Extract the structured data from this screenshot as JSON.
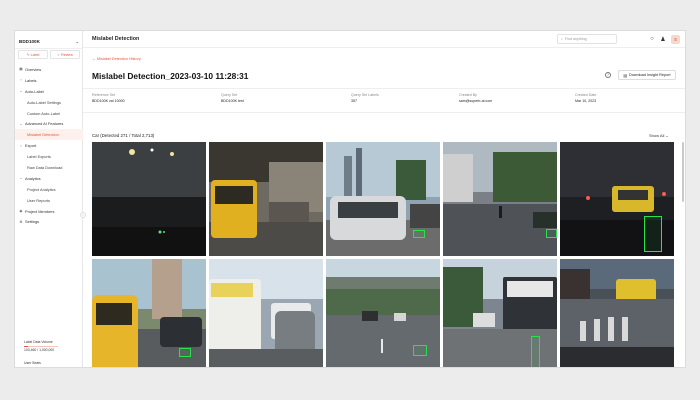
{
  "sidebar": {
    "workspace": "BDD100K",
    "label_button": "Label",
    "review_button": "Review",
    "items": [
      {
        "label": "Overview",
        "icon": "grid-icon"
      },
      {
        "label": "Labels",
        "icon": "chevron-right-icon"
      },
      {
        "label": "Auto-Label",
        "icon": "chevron-down-icon"
      },
      {
        "label": "Auto-Label Settings"
      },
      {
        "label": "Custom Auto-Label"
      },
      {
        "label": "Advanced AI Features",
        "icon": "chevron-down-icon"
      },
      {
        "label": "Mislabel Detection"
      },
      {
        "label": "Export",
        "icon": "chevron-right-icon"
      },
      {
        "label": "Label Exports"
      },
      {
        "label": "Raw Data Download"
      },
      {
        "label": "Analytics",
        "icon": "chevron-down-icon"
      },
      {
        "label": "Project Analytics"
      },
      {
        "label": "User Reports"
      },
      {
        "label": "Project Members",
        "icon": "people-icon"
      },
      {
        "label": "Settings",
        "icon": "gear-icon"
      }
    ],
    "usage_title": "Label Data Volume",
    "usage_value": "103,460 / 1,000,000",
    "usage_fraction": 0.103,
    "user_seats": "User Seats"
  },
  "topbar": {
    "title": "Mislabel Detection",
    "search_placeholder": "Find anything",
    "avatar_initial": "S"
  },
  "main": {
    "back_link": "Mislabel Detection History",
    "title": "Mislabel Detection_2023-03-10 11:28:31",
    "download_button": "Download Insight Report",
    "meta": [
      {
        "key": "Reference Set",
        "value": "BDD100K val 10000"
      },
      {
        "key": "Query Set",
        "value": "BDD100K test"
      },
      {
        "key": "Query Set Labels",
        "value": "357"
      },
      {
        "key": "Created By",
        "value": "sam@superb-ai.com"
      },
      {
        "key": "Created Date",
        "value": "Mar 10, 2023"
      }
    ],
    "section_title": "Car (Detected 271 / Total 2,713)",
    "show_all": "Show All"
  },
  "colors": {
    "accent": "#e8543a",
    "bbox": "#27e34a"
  }
}
